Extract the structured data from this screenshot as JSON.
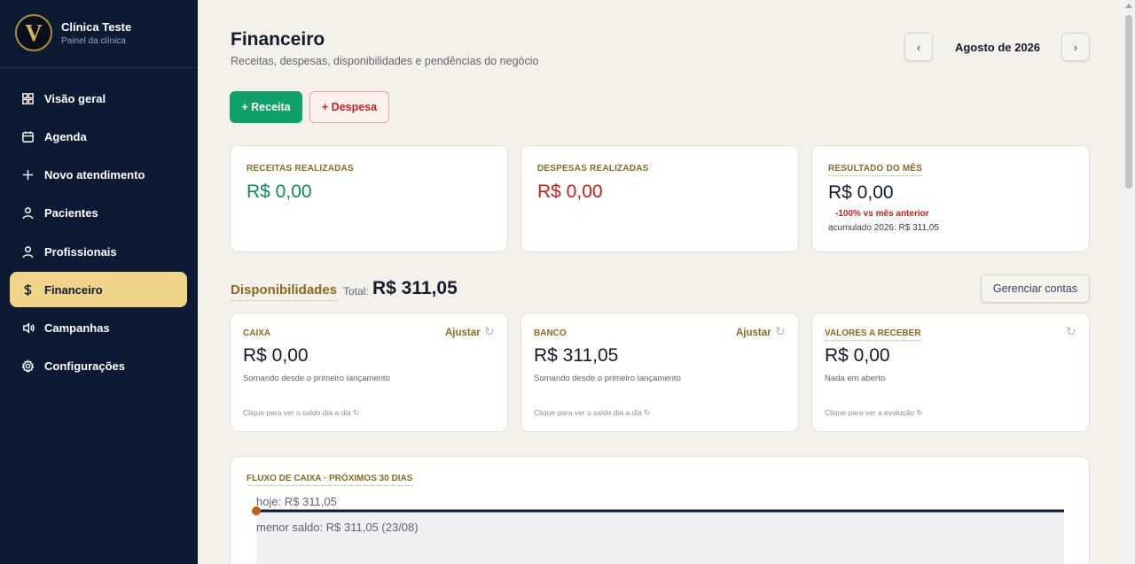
{
  "sidebar": {
    "brand_initial": "V",
    "brand_name": "Clínica Teste",
    "brand_sub": "Painel da clínica",
    "items": [
      {
        "label": "Visão geral",
        "icon": "grid-icon"
      },
      {
        "label": "Agenda",
        "icon": "calendar-icon"
      },
      {
        "label": "Novo atendimento",
        "icon": "plus-icon"
      },
      {
        "label": "Pacientes",
        "icon": "user-icon"
      },
      {
        "label": "Profissionais",
        "icon": "user-icon"
      },
      {
        "label": "Financeiro",
        "icon": "dollar-icon",
        "active": true
      },
      {
        "label": "Campanhas",
        "icon": "megaphone-icon"
      },
      {
        "label": "Configurações",
        "icon": "gear-icon"
      }
    ]
  },
  "header": {
    "title": "Financeiro",
    "subtitle": "Receitas, despesas, disponibilidades e pendências do negócio",
    "prev": "‹",
    "next": "›",
    "month": "Agosto de 2026"
  },
  "actions": {
    "receita": "+ Receita",
    "despesa": "+ Despesa"
  },
  "summary": {
    "receitas_label": "RECEITAS REALIZADAS",
    "receitas_value": "R$ 0,00",
    "despesas_label": "DESPESAS REALIZADAS",
    "despesas_value": "R$ 0,00",
    "resultado_label": "RESULTADO DO MÊS",
    "resultado_value": "R$ 0,00",
    "resultado_delta": "-100% vs mês anterior",
    "resultado_accum": "acumulado 2026: R$ 311,05"
  },
  "disponibilidades": {
    "title": "Disponibilidades",
    "total_label": "Total:",
    "total_value": "R$ 311,05",
    "manage": "Gerenciar contas",
    "caixa": {
      "label": "CAIXA",
      "action": "Ajustar",
      "value": "R$ 0,00",
      "desc": "Somando desde o primeiro lançamento",
      "foot": "Clique para ver o saldo dia a dia ↻"
    },
    "banco": {
      "label": "BANCO",
      "action": "Ajustar",
      "value": "R$ 311,05",
      "desc": "Somando desde o primeiro lançamento",
      "foot": "Clique para ver o saldo dia a dia ↻"
    },
    "receber": {
      "label": "VALORES A RECEBER",
      "value": "R$ 0,00",
      "desc": "Nada em aberto",
      "foot": "Clique para ver a evolução ↻"
    },
    "refresh_glyph": "↻"
  },
  "fluxo": {
    "label": "FLUXO DE CAIXA · PRÓXIMOS 30 DIAS",
    "today_label": "hoje: R$ 311,05",
    "min_label": "menor saldo: R$ 311,05 (23/08)",
    "line_color": "#0c1a33",
    "marker_color": "#c25e12",
    "fill_color": "#eff0f1",
    "balance": [
      311.05,
      311.05
    ]
  }
}
